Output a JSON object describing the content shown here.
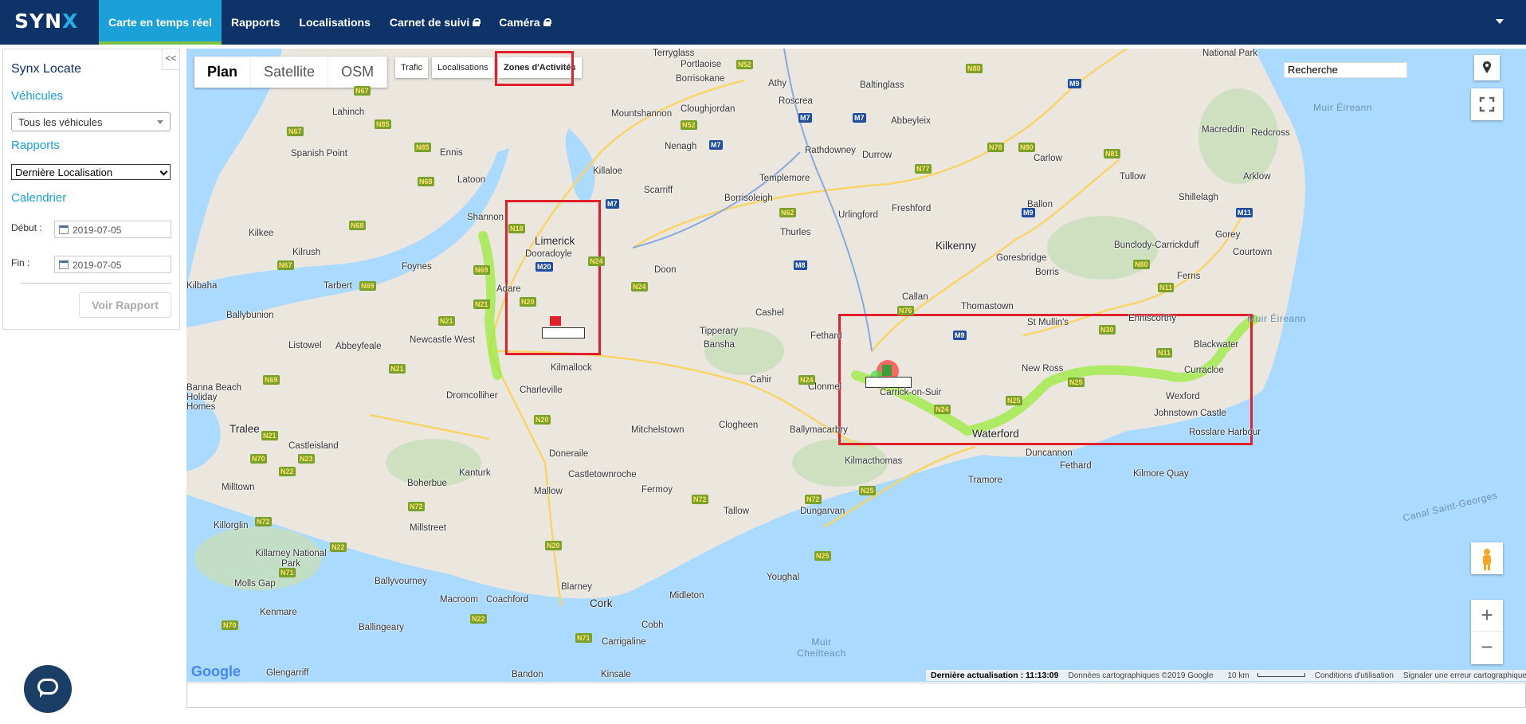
{
  "nav": {
    "logo": "SYN",
    "logo_x": "X",
    "items": [
      {
        "label": "Carte en temps réel",
        "active": true,
        "locked": false
      },
      {
        "label": "Rapports",
        "active": false,
        "locked": false
      },
      {
        "label": "Localisations",
        "active": false,
        "locked": false
      },
      {
        "label": "Carnet de suivi",
        "active": false,
        "locked": true
      },
      {
        "label": "Caméra",
        "active": false,
        "locked": true
      }
    ],
    "menu_icon": "chevron-down-icon"
  },
  "sidebar": {
    "collapse_label": "<<",
    "title": "Synx Locate",
    "vehicles_heading": "Véhicules",
    "vehicles_select": "Tous les véhicules",
    "reports_heading": "Rapports",
    "report_select": "Dernière Localisation",
    "calendar_heading": "Calendrier",
    "start_label": "Début :",
    "start_date": "2019-07-05",
    "end_label": "Fin :",
    "end_date": "2019-07-05",
    "view_report_button": "Voir Rapport"
  },
  "map": {
    "type_buttons": [
      "Plan",
      "Satellite",
      "OSM"
    ],
    "selected_type": "Plan",
    "layer_buttons": [
      "Trafic",
      "Localisations",
      "Zones d'Activités"
    ],
    "search_value": "Recherche",
    "google_logo": "Google",
    "last_update": "Dernière actualisation : 11:13:09",
    "map_data": "Données cartographiques ©2019 Google",
    "scale": "10 km",
    "terms": "Conditions d'utilisation",
    "report_error": "Signaler une erreur cartographique",
    "sea_labels": [
      "Muir Éireann",
      "Muir Éireann",
      "Canal Saint-Georges",
      "Muir Cheilteach"
    ],
    "places": [
      "Portlaoise",
      "Athy",
      "Baltinglass",
      "National Park",
      "Macreddin",
      "Redcross",
      "Arklow",
      "Tullow",
      "Shillelagh",
      "Carlow",
      "Ballon",
      "Gorey",
      "Courtown",
      "Bunclody-Carrickduff",
      "Ferns",
      "Enniscorthy",
      "Blackwater",
      "Curracloe",
      "Wexford",
      "Johnstown Castle",
      "Rosslare Harbour",
      "Kilmore Quay",
      "Fethard",
      "Duncannon",
      "Tramore",
      "Waterford",
      "New Ross",
      "St Mullin's",
      "Thomastown",
      "Kilkenny",
      "Goresbridge",
      "Borris",
      "Callan",
      "Freshford",
      "Abbeyleix",
      "Durrow",
      "Rathdowney",
      "Urlingford",
      "Templemore",
      "Roscrea",
      "Borrisoleigh",
      "Thurles",
      "Nenagh",
      "Cloughjordan",
      "Borrisokane",
      "Terryglass",
      "Mountshannon",
      "Killaloe",
      "Scarriff",
      "Ennis",
      "Latoon",
      "Lahinch",
      "Spanish Point",
      "Shannon",
      "Kilkee",
      "Kilrush",
      "Foynes",
      "Tarbert",
      "Kilbaha",
      "Ballybunion",
      "Listowel",
      "Newcastle West",
      "Abbeyfeale",
      "Adare",
      "Limerick",
      "Dooradoyle",
      "Doon",
      "Cashel",
      "Tipperary",
      "Bansha",
      "Kilmallock",
      "Charleville",
      "Dromcolliher",
      "Fethard",
      "Clonmel",
      "Cahir",
      "Carrick-on-Suir",
      "Mitchelstown",
      "Clogheen",
      "Ballymacarbry",
      "Kilmacthomas",
      "Doneraile",
      "Castletownroche",
      "Fermoy",
      "Tallow",
      "Dungarvan",
      "Mallow",
      "Kanturk",
      "Boherbue",
      "Millstreet",
      "Tralee",
      "Banna Beach Holiday Homes",
      "Castleisland",
      "Milltown",
      "Killorglin",
      "Killarney National Park",
      "Molls Gap",
      "Kenmare",
      "Ballyvourney",
      "Macroom",
      "Coachford",
      "Blarney",
      "Cork",
      "Midleton",
      "Cobh",
      "Carrigaline",
      "Youghal",
      "Ballingeary",
      "Glengarriff",
      "Bandon",
      "Kinsale"
    ],
    "vehicles": [
      {
        "color": "#e0202a",
        "label": ""
      },
      {
        "color": "#3a9e3a",
        "label": ""
      }
    ]
  },
  "chat_icon": "chat-bubble-icon"
}
